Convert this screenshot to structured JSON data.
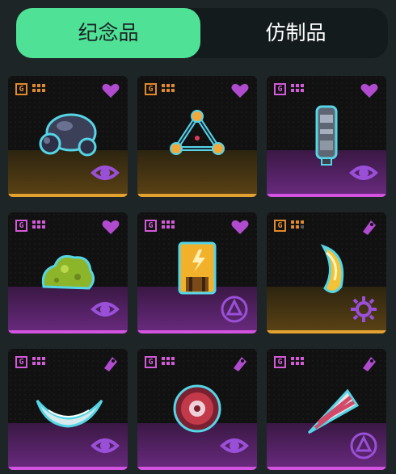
{
  "tabs": [
    {
      "label": "纪念品",
      "active": true
    },
    {
      "label": "仿制品",
      "active": false
    }
  ],
  "colors": {
    "tab_active_bg": "#4fe296",
    "rarity_gold": "#e3a12f",
    "rarity_purple": "#d353e0",
    "fav": "#b04bd0"
  },
  "items": [
    {
      "name": "stone-cluster",
      "rarity": "gold",
      "fav": "heart-icon",
      "emblem": "eye-emblem-icon",
      "level_dots": 6
    },
    {
      "name": "triangle-orb",
      "rarity": "gold",
      "fav": "heart-icon",
      "emblem": "none",
      "level_dots": 6
    },
    {
      "name": "metal-capsule",
      "rarity": "purple",
      "fav": "heart-icon",
      "emblem": "eye-emblem-icon",
      "level_dots": 6
    },
    {
      "name": "green-slime",
      "rarity": "purple",
      "fav": "heart-icon",
      "emblem": "eye-emblem-icon",
      "level_dots": 6
    },
    {
      "name": "lightning-battery",
      "rarity": "purple",
      "fav": "heart-icon",
      "emblem": "circle-emblem-icon",
      "level_dots": 6
    },
    {
      "name": "golden-fang",
      "rarity": "gold",
      "fav": "tag-icon",
      "emblem": "sun-emblem-icon",
      "level_dots": 5
    },
    {
      "name": "white-crescent",
      "rarity": "purple",
      "fav": "tag-icon",
      "emblem": "eye-emblem-icon",
      "level_dots": 6
    },
    {
      "name": "red-shield-orb",
      "rarity": "purple",
      "fav": "tag-icon",
      "emblem": "eye-emblem-icon",
      "level_dots": 6
    },
    {
      "name": "striped-drill",
      "rarity": "purple",
      "fav": "tag-icon",
      "emblem": "circle-emblem-icon",
      "level_dots": 6
    }
  ]
}
